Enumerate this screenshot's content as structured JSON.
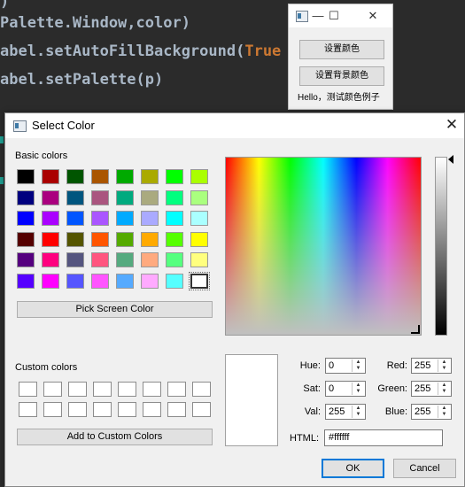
{
  "code": {
    "lines": [
      {
        "text": ")",
        "keyword": ""
      },
      {
        "text": "Palette.Window,color)",
        "keyword": ""
      },
      {
        "text": "abel.setAutoFillBackground(",
        "keyword": "True"
      },
      {
        "text": "abel.setPalette(p)",
        "keyword": ""
      }
    ]
  },
  "demo_window": {
    "minimize": "—",
    "maximize": "☐",
    "close": "✕",
    "button1": "设置颜色",
    "button2": "设置背景颜色",
    "label": "Hello，测试颜色例子"
  },
  "dialog": {
    "title": "Select Color",
    "close_symbol": "✕",
    "basic_colors_label": "Basic colors",
    "basic_colors": [
      [
        "#000000",
        "#aa0000",
        "#005500",
        "#aa5500",
        "#00aa00",
        "#aaaa00",
        "#00ff00",
        "#aaff00"
      ],
      [
        "#00007f",
        "#aa007f",
        "#00557f",
        "#aa557f",
        "#00aa7f",
        "#aaaa7f",
        "#00ff7f",
        "#aaff7f"
      ],
      [
        "#0000ff",
        "#aa00ff",
        "#0055ff",
        "#aa55ff",
        "#00aaff",
        "#aaaaff",
        "#00ffff",
        "#aaffff"
      ],
      [
        "#550000",
        "#ff0000",
        "#555500",
        "#ff5500",
        "#55aa00",
        "#ffaa00",
        "#55ff00",
        "#ffff00"
      ],
      [
        "#55007f",
        "#ff007f",
        "#55557f",
        "#ff557f",
        "#55aa7f",
        "#ffaa7f",
        "#55ff7f",
        "#ffff7f"
      ],
      [
        "#5500ff",
        "#ff00ff",
        "#5555ff",
        "#ff55ff",
        "#55aaff",
        "#ffaaff",
        "#55ffff",
        "#ffffff"
      ]
    ],
    "selected_color": "#ffffff",
    "pick_screen_color": "Pick Screen Color",
    "custom_colors_label": "Custom colors",
    "add_to_custom_colors": "Add to Custom Colors",
    "fields": {
      "hue_label": "Hue:",
      "hue": "0",
      "sat_label": "Sat:",
      "sat": "0",
      "val_label": "Val:",
      "val": "255",
      "red_label": "Red:",
      "red": "255",
      "green_label": "Green:",
      "green": "255",
      "blue_label": "Blue:",
      "blue": "255",
      "html_label": "HTML:",
      "html": "#ffffff"
    },
    "ok": "OK",
    "cancel": "Cancel"
  }
}
